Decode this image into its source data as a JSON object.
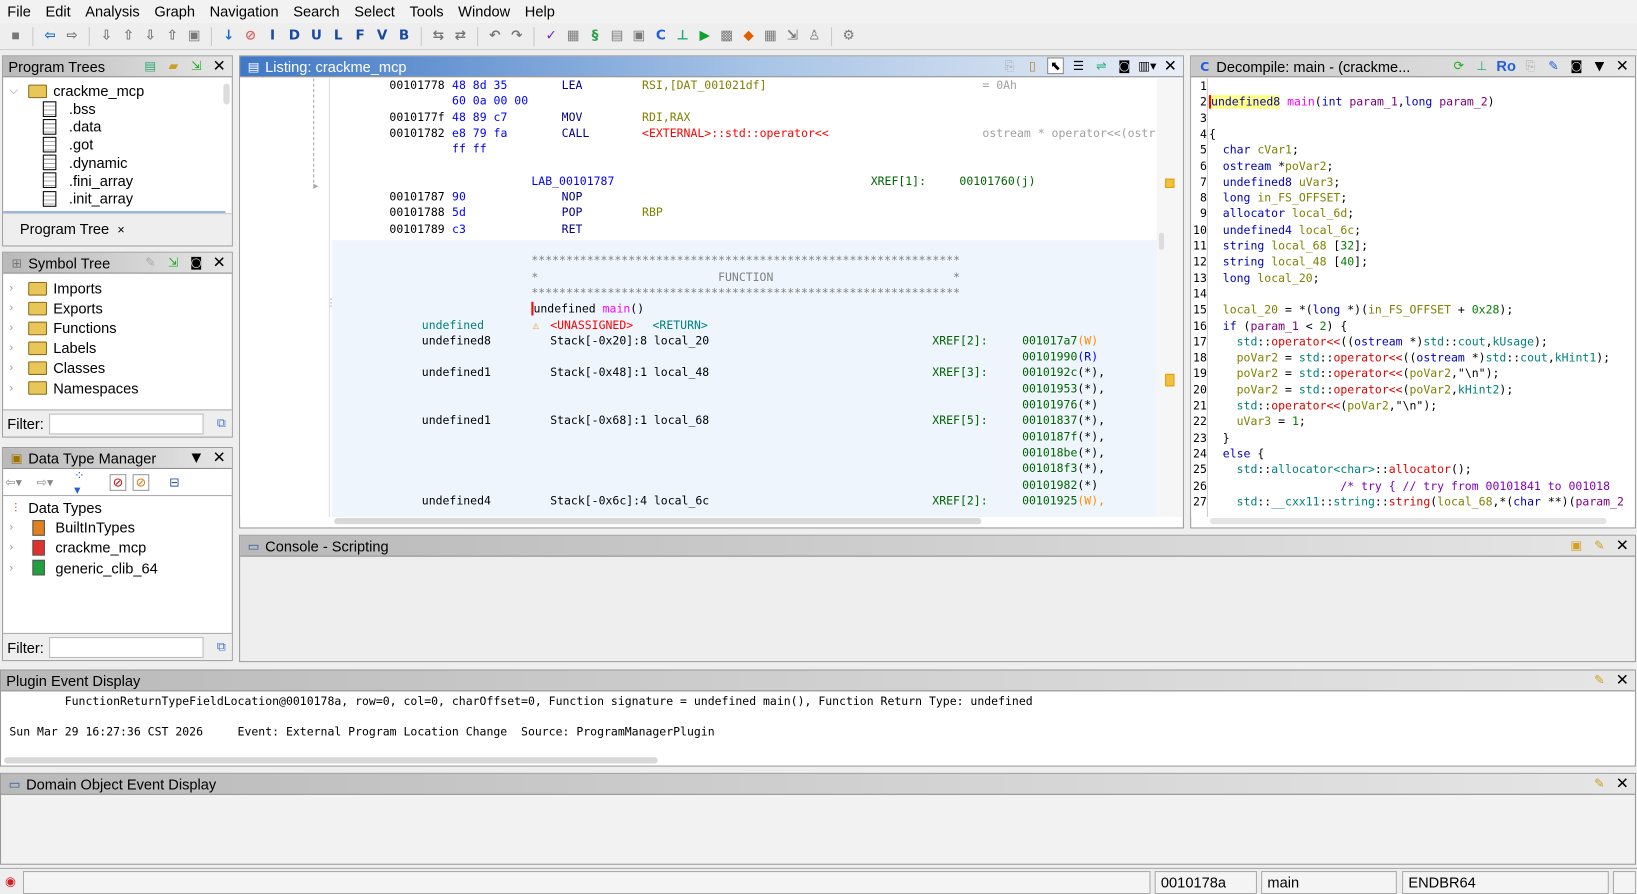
{
  "menu": [
    "File",
    "Edit",
    "Analysis",
    "Graph",
    "Navigation",
    "Search",
    "Select",
    "Tools",
    "Window",
    "Help"
  ],
  "toolbar": {
    "icons": [
      "save-icon",
      "sep",
      "back-icon",
      "forward-icon",
      "sep",
      "nav1-icon",
      "nav2-icon",
      "nav3-icon",
      "nav4-icon",
      "nav5-icon",
      "sep",
      "down-arrow-icon",
      "stop-icon"
    ],
    "letter_buttons": [
      "I",
      "D",
      "U",
      "L",
      "F",
      "V",
      "B"
    ],
    "icons2": [
      "sep",
      "nav6-icon",
      "nav7-icon",
      "sep",
      "undo-icon",
      "redo-icon",
      "sep",
      "check-icon",
      "bytes-icon",
      "script-icon",
      "list-icon",
      "datatype-icon",
      "decompile-icon",
      "graph-icon",
      "run-icon",
      "chip-icon",
      "diamond-icon",
      "table-icon",
      "export-icon",
      "tree-icon",
      "sep",
      "config-icon"
    ]
  },
  "program_trees": {
    "title": "Program Trees",
    "root": "crackme_mcp",
    "items": [
      ".bss",
      ".data",
      ".got",
      ".dynamic",
      ".fini_array",
      ".init_array"
    ],
    "tab": "Program Tree",
    "tab_close": "×"
  },
  "symbol_tree": {
    "title": "Symbol Tree",
    "items": [
      "Imports",
      "Exports",
      "Functions",
      "Labels",
      "Classes",
      "Namespaces"
    ],
    "filter_label": "Filter:",
    "filter_value": ""
  },
  "data_type_manager": {
    "title": "Data Type Manager",
    "root": "Data Types",
    "items": [
      "BuiltInTypes",
      "crackme_mcp",
      "generic_clib_64"
    ],
    "item_colors": [
      "#e08020",
      "#e03030",
      "#20a040"
    ],
    "filter_label": "Filter:",
    "filter_value": ""
  },
  "listing": {
    "title": "Listing:  crackme_mcp",
    "rows": [
      {
        "addr": "00101778",
        "bytes": "48 8d 35",
        "mn": "LEA",
        "op": "RSI,[DAT_001021df]",
        "cmt": "= 0Ah"
      },
      {
        "bytes": "60 0a 00 00"
      },
      {
        "addr": "0010177f",
        "bytes": "48 89 c7",
        "mn": "MOV",
        "op": "RDI,RAX"
      },
      {
        "addr": "00101782",
        "bytes": "e8 79 fa",
        "mn": "CALL",
        "ext": "<EXTERNAL>::std::operator<<",
        "cmt": "ostream * operator<<(ostr"
      },
      {
        "bytes": "ff ff"
      },
      {},
      {
        "label": "LAB_00101787",
        "xref": "XREF[1]:",
        "xt": "00101760(j)"
      },
      {
        "addr": "00101787",
        "bytes": "90",
        "mn": "NOP"
      },
      {
        "addr": "00101788",
        "bytes": "5d",
        "mn": "POP",
        "op": "RBP"
      },
      {
        "addr": "00101789",
        "bytes": "c3",
        "mn": "RET"
      },
      {},
      {
        "star": "**************************************************************"
      },
      {
        "star": "*                          FUNCTION                          *"
      },
      {
        "star": "**************************************************************"
      },
      {
        "sig_type": "undefined ",
        "sig_name": "main",
        "sig_rest": "()"
      },
      {
        "vtype": "undefined",
        "unassigned": "<UNASSIGNED>",
        "ret": "<RETURN>"
      },
      {
        "ptype": "undefined8",
        "stor": "Stack[-0x20]:8 local_20",
        "xref": "XREF[2]:",
        "xt": "001017a7",
        "xs": "(W)"
      },
      {
        "xt": "00101990",
        "xs": "(R)"
      },
      {
        "ptype": "undefined1",
        "stor": "Stack[-0x48]:1 local_48",
        "xref": "XREF[3]:",
        "xt": "0010192c",
        "xs": "(*),"
      },
      {
        "xt": "00101953",
        "xs": "(*),"
      },
      {
        "xt": "00101976",
        "xs": "(*)"
      },
      {
        "ptype": "undefined1",
        "stor": "Stack[-0x68]:1 local_68",
        "xref": "XREF[5]:",
        "xt": "00101837",
        "xs": "(*),"
      },
      {
        "xt": "0010187f",
        "xs": "(*),"
      },
      {
        "xt": "001018be",
        "xs": "(*),"
      },
      {
        "xt": "001018f3",
        "xs": "(*),"
      },
      {
        "xt": "00101982",
        "xs": "(*)"
      },
      {
        "ptype": "undefined4",
        "stor": "Stack[-0x6c]:4 local_6c",
        "xref": "XREF[2]:",
        "xt": "00101925",
        "xs": "(W),"
      }
    ]
  },
  "decompile": {
    "title": "Decompile: main -  (crackme...",
    "ro_label": "Ro",
    "lines": [
      [],
      [
        [
          "undefined8",
          "t hl"
        ],
        [
          " "
        ],
        [
          "main",
          "fm"
        ],
        [
          "("
        ],
        [
          "int",
          "t"
        ],
        [
          " "
        ],
        [
          "param_1",
          "p"
        ],
        [
          ","
        ],
        [
          "long",
          "t"
        ],
        [
          " "
        ],
        [
          "param_2",
          "p"
        ],
        [
          ")"
        ]
      ],
      [],
      [
        [
          "{"
        ]
      ],
      [
        [
          "  "
        ],
        [
          "char",
          "t"
        ],
        [
          " "
        ],
        [
          "cVar1",
          "v"
        ],
        [
          ";"
        ]
      ],
      [
        [
          "  "
        ],
        [
          "ostream",
          "t"
        ],
        [
          " *"
        ],
        [
          "poVar2",
          "v"
        ],
        [
          ";"
        ]
      ],
      [
        [
          "  "
        ],
        [
          "undefined8",
          "t"
        ],
        [
          " "
        ],
        [
          "uVar3",
          "v"
        ],
        [
          ";"
        ]
      ],
      [
        [
          "  "
        ],
        [
          "long",
          "t"
        ],
        [
          " "
        ],
        [
          "in_FS_OFFSET",
          "v"
        ],
        [
          ";"
        ]
      ],
      [
        [
          "  "
        ],
        [
          "allocator",
          "t"
        ],
        [
          " "
        ],
        [
          "local_6d",
          "v"
        ],
        [
          ";"
        ]
      ],
      [
        [
          "  "
        ],
        [
          "undefined4",
          "t"
        ],
        [
          " "
        ],
        [
          "local_6c",
          "v"
        ],
        [
          ";"
        ]
      ],
      [
        [
          "  "
        ],
        [
          "string",
          "t"
        ],
        [
          " "
        ],
        [
          "local_68",
          "v"
        ],
        [
          " ["
        ],
        [
          "32",
          "n"
        ],
        [
          "];"
        ]
      ],
      [
        [
          "  "
        ],
        [
          "string",
          "t"
        ],
        [
          " "
        ],
        [
          "local_48",
          "v"
        ],
        [
          " ["
        ],
        [
          "40",
          "n"
        ],
        [
          "];"
        ]
      ],
      [
        [
          "  "
        ],
        [
          "long",
          "t"
        ],
        [
          " "
        ],
        [
          "local_20",
          "v"
        ],
        [
          ";"
        ]
      ],
      [],
      [
        [
          "  "
        ],
        [
          "local_20",
          "v"
        ],
        [
          " = *("
        ],
        [
          "long",
          "t"
        ],
        [
          " *)("
        ],
        [
          "in_FS_OFFSET",
          "v"
        ],
        [
          " + "
        ],
        [
          "0x28",
          "n"
        ],
        [
          ");"
        ]
      ],
      [
        [
          "  "
        ],
        [
          "if",
          "t"
        ],
        [
          " ("
        ],
        [
          "param_1",
          "p"
        ],
        [
          " < "
        ],
        [
          "2",
          "n"
        ],
        [
          ") {"
        ]
      ],
      [
        [
          "    "
        ],
        [
          "std",
          "ns"
        ],
        [
          "::"
        ],
        [
          "operator<<",
          "fn"
        ],
        [
          "(("
        ],
        [
          "ostream",
          "t"
        ],
        [
          " *)"
        ],
        [
          "std",
          "ns"
        ],
        [
          "::"
        ],
        [
          "cout",
          "ns"
        ],
        [
          ","
        ],
        [
          "kUsage",
          "ns"
        ],
        [
          ");"
        ]
      ],
      [
        [
          "    "
        ],
        [
          "poVar2",
          "v"
        ],
        [
          " = "
        ],
        [
          "std",
          "ns"
        ],
        [
          "::"
        ],
        [
          "operator<<",
          "fn"
        ],
        [
          "(("
        ],
        [
          "ostream",
          "t"
        ],
        [
          " *)"
        ],
        [
          "std",
          "ns"
        ],
        [
          "::"
        ],
        [
          "cout",
          "ns"
        ],
        [
          ","
        ],
        [
          "kHint1",
          "ns"
        ],
        [
          ");"
        ]
      ],
      [
        [
          "    "
        ],
        [
          "poVar2",
          "v"
        ],
        [
          " = "
        ],
        [
          "std",
          "ns"
        ],
        [
          "::"
        ],
        [
          "operator<<",
          "fn"
        ],
        [
          "("
        ],
        [
          "poVar2",
          "v"
        ],
        [
          ",\"\\n\");"
        ]
      ],
      [
        [
          "    "
        ],
        [
          "poVar2",
          "v"
        ],
        [
          " = "
        ],
        [
          "std",
          "ns"
        ],
        [
          "::"
        ],
        [
          "operator<<",
          "fn"
        ],
        [
          "("
        ],
        [
          "poVar2",
          "v"
        ],
        [
          ","
        ],
        [
          "kHint2",
          "ns"
        ],
        [
          ");"
        ]
      ],
      [
        [
          "    "
        ],
        [
          "std",
          "ns"
        ],
        [
          "::"
        ],
        [
          "operator<<",
          "fn"
        ],
        [
          "("
        ],
        [
          "poVar2",
          "v"
        ],
        [
          ",\"\\n\");"
        ]
      ],
      [
        [
          "    "
        ],
        [
          "uVar3",
          "v"
        ],
        [
          " = "
        ],
        [
          "1",
          "n"
        ],
        [
          ";"
        ]
      ],
      [
        [
          "  }"
        ]
      ],
      [
        [
          "  "
        ],
        [
          "else",
          "t"
        ],
        [
          " {"
        ]
      ],
      [
        [
          "    "
        ],
        [
          "std",
          "ns"
        ],
        [
          "::"
        ],
        [
          "allocator<char>",
          "ns"
        ],
        [
          "::"
        ],
        [
          "allocator",
          "fn"
        ],
        [
          "();"
        ]
      ],
      [
        [
          "                   "
        ],
        [
          "/* try { // try from 00101841 to 001018",
          "cm"
        ]
      ],
      [
        [
          "    "
        ],
        [
          "std",
          "ns"
        ],
        [
          "::"
        ],
        [
          "__cxx11",
          "ns"
        ],
        [
          "::"
        ],
        [
          "string",
          "ns"
        ],
        [
          "::"
        ],
        [
          "string",
          "fn"
        ],
        [
          "("
        ],
        [
          "local_68",
          "v"
        ],
        [
          ",*("
        ],
        [
          "char",
          "t"
        ],
        [
          " **)("
        ],
        [
          "param_2",
          "p"
        ]
      ]
    ]
  },
  "console": {
    "title": "Console - Scripting"
  },
  "plugin_events": {
    "title": "Plugin Event Display",
    "lines": [
      "        FunctionReturnTypeFieldLocation@0010178a, row=0, col=0, charOffset=0, Function signature = undefined main(), Function Return Type: undefined",
      "",
      "Sun Mar 29 16:27:36 CST 2026     Event: External Program Location Change  Source: ProgramManagerPlugin"
    ]
  },
  "domain_events": {
    "title": "Domain Object Event Display"
  },
  "status": {
    "address": "0010178a",
    "function": "main",
    "instruction": "ENDBR64"
  }
}
